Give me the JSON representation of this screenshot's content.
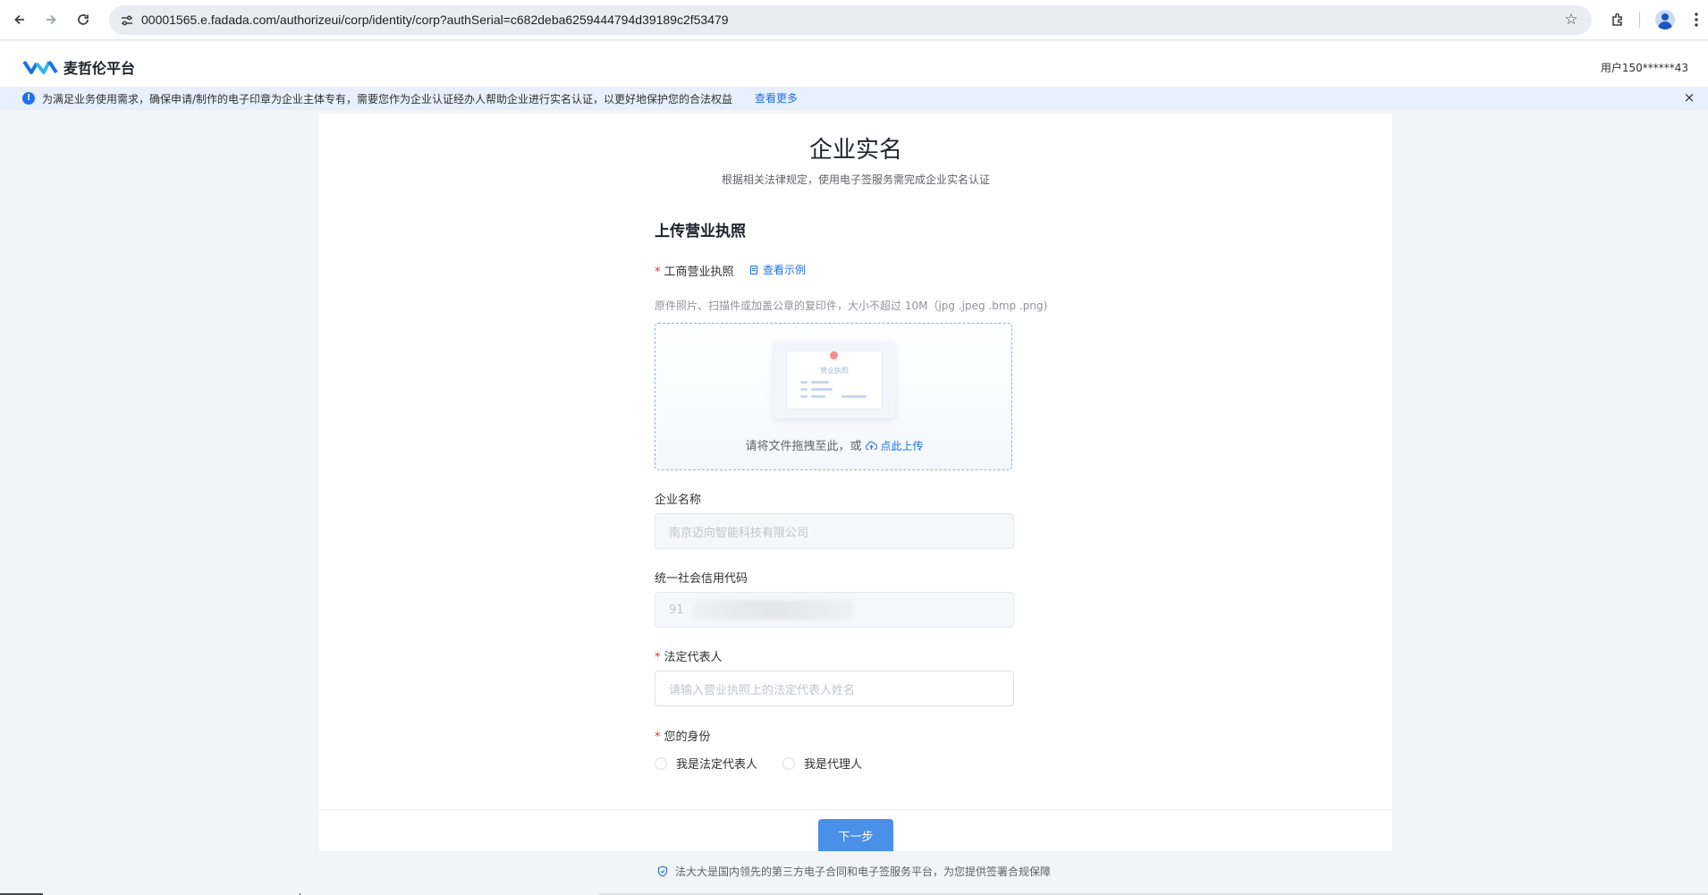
{
  "browser": {
    "url": "00001565.e.fadada.com/authorizeui/corp/identity/corp?authSerial=c682deba6259444794d39189c2f53479"
  },
  "header": {
    "logo_text": "麦哲伦平台",
    "user": "用户150******43"
  },
  "notice": {
    "icon": "!",
    "text": "为满足业务使用需求，确保申请/制作的电子印章为企业主体专有，需要您作为企业认证经办人帮助企业进行实名认证，以更好地保护您的合法权益",
    "link": "查看更多",
    "close": "×"
  },
  "page": {
    "title": "企业实名",
    "subtitle": "根据相关法律规定，使用电子签服务需完成企业实名认证"
  },
  "upload_section": {
    "title": "上传营业执照",
    "required_mark": "*",
    "license_label": "工商营业执照",
    "example_link": "查看示例",
    "hint": "原件照片、扫描件或加盖公章的复印件，大小不超过 10M（jpg .jpeg .bmp .png)",
    "illustration_title": "营业执照",
    "drop_text": "请将文件拖拽至此，或",
    "upload_link": "点此上传"
  },
  "form": {
    "company_name_label": "企业名称",
    "company_name_value": "南京迈向智能科技有限公司",
    "credit_code_label": "统一社会信用代码",
    "credit_code_value": "91",
    "legal_rep_label": "法定代表人",
    "legal_rep_placeholder": "请输入营业执照上的法定代表人姓名",
    "identity_label": "您的身份",
    "identity_options": [
      "我是法定代表人",
      "我是代理人"
    ]
  },
  "next_button": "下一步",
  "footer": {
    "text": "法大大是国内领先的第三方电子合同和电子签服务平台，为您提供签署合规保障"
  },
  "colors": {
    "brand": "#1f6fe8",
    "primary_button": "#4a90e8",
    "required": "#f5222d",
    "notice_bg": "#e8f0fd"
  }
}
